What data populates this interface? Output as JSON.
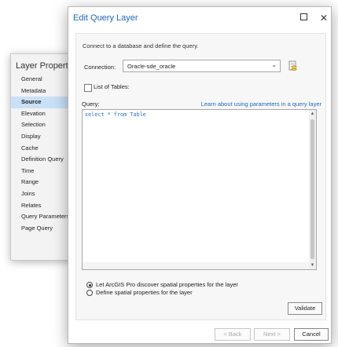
{
  "layer_properties": {
    "title": "Layer Properties",
    "nav_items": [
      {
        "label": "General"
      },
      {
        "label": "Metadata"
      },
      {
        "label": "Source",
        "selected": true
      },
      {
        "label": "Elevation"
      },
      {
        "label": "Selection"
      },
      {
        "label": "Display"
      },
      {
        "label": "Cache"
      },
      {
        "label": "Definition Query"
      },
      {
        "label": "Time"
      },
      {
        "label": "Range"
      },
      {
        "label": "Joins"
      },
      {
        "label": "Relates"
      },
      {
        "label": "Query Parameters"
      },
      {
        "label": "Page Query"
      }
    ]
  },
  "dialog": {
    "title": "Edit Query Layer",
    "maximize_icon": "maximize-icon",
    "close_icon": "close-icon",
    "intro": "Connect to a database and define the query.",
    "connection": {
      "label": "Connection:",
      "value": "Oracle-sde_oracle",
      "icon": "database-connection-icon"
    },
    "list_of_tables": {
      "label": "List of Tables:",
      "checked": false
    },
    "query": {
      "label": "Query:",
      "help_link": "Learn about using parameters in a query layer",
      "text": "select * from Table"
    },
    "spatial_options": [
      {
        "label": "Let ArcGIS Pro discover spatial properties for the layer",
        "selected": true
      },
      {
        "label": "Define spatial properties for the layer",
        "selected": false
      }
    ],
    "validate_label": "Validate",
    "footer": {
      "back": "< Back",
      "next": "Next >",
      "cancel": "Cancel"
    }
  },
  "colors": {
    "title_text": "#1f66b8",
    "link": "#1a6cc4",
    "selected_nav": "#c9e0f7",
    "code": "#2a6fc9"
  }
}
